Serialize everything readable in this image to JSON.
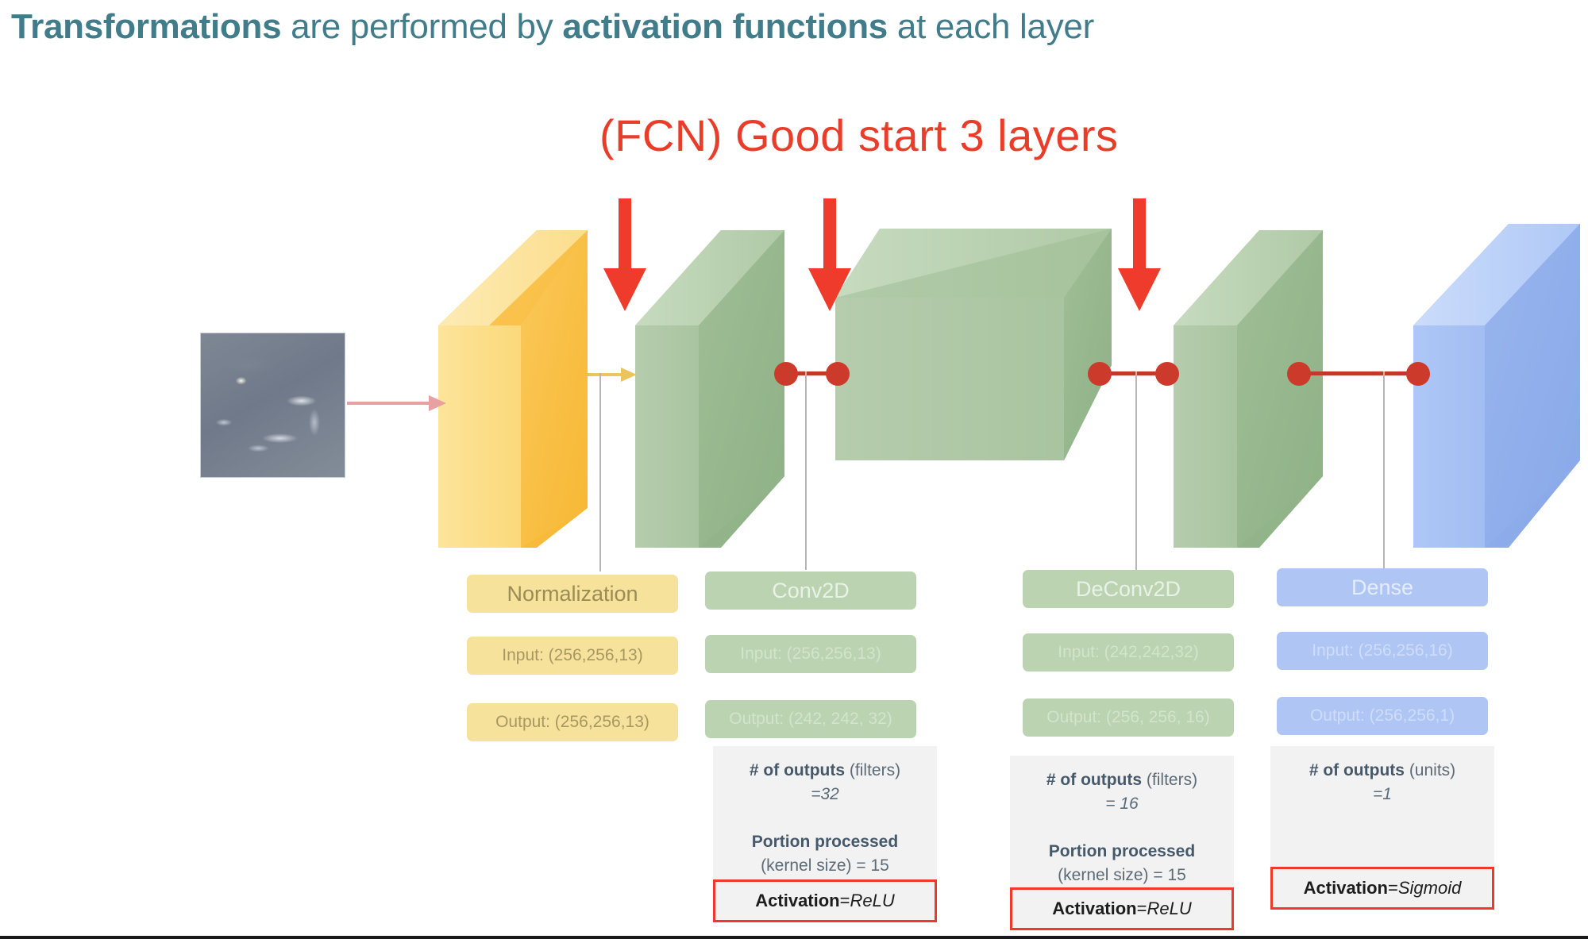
{
  "title": {
    "part1": "Transformations",
    "part2": " are performed by ",
    "part3": "activation functions",
    "part4": " at each layer",
    "color": "#417C8B"
  },
  "annotation": {
    "text": "(FCN) Good start 3 layers",
    "color": "#EA3C2A"
  },
  "arrows": {
    "count": 3,
    "color": "#EE3B2B"
  },
  "colors": {
    "yellow_face": "#FCE18A",
    "yellow_pill": "#F7E29C",
    "green_face": "#B1C8A8",
    "green_pill": "#BBD3B1",
    "blue_face": "#A8C4F5",
    "blue_pill": "#AFC5F3",
    "connector_red": "#CC3A2B",
    "activation_border": "#F0392B",
    "input_arrow": "#E8A0A0",
    "norm_arrow": "#E8C463"
  },
  "input": {
    "name": "input-satellite-image"
  },
  "layers": [
    {
      "id": "normalization",
      "name": "Normalization",
      "input": "Input: (256,256,13)",
      "output": "Output: (256,256,13)",
      "theme": "yellow",
      "details": null,
      "activation": null
    },
    {
      "id": "conv2d",
      "name": "Conv2D",
      "input": "Input: (256,256,13)",
      "output": "Output: (242, 242, 32)",
      "theme": "green",
      "details": {
        "outputs_label": "# of outputs",
        "outputs_kind": "(filters)",
        "outputs_value": "=32",
        "portion_label": "Portion processed",
        "portion_value": "(kernel size) = 15"
      },
      "activation": {
        "label": "Activation",
        "eq": " = ",
        "value": "ReLU"
      }
    },
    {
      "id": "deconv2d",
      "name": "DeConv2D",
      "input": "Input: (242,242,32)",
      "output": "Output: (256, 256, 16)",
      "theme": "green",
      "details": {
        "outputs_label": "# of outputs",
        "outputs_kind": "(filters)",
        "outputs_value": "= 16",
        "portion_label": "Portion processed",
        "portion_value": "(kernel size) = 15"
      },
      "activation": {
        "label": "Activation",
        "eq": " = ",
        "value": "ReLU"
      }
    },
    {
      "id": "dense",
      "name": "Dense",
      "input": "Input: (256,256,16)",
      "output": "Output: (256,256,1)",
      "theme": "blue",
      "details": {
        "outputs_label": "# of outputs",
        "outputs_kind": "(units)",
        "outputs_value": "=1",
        "portion_label": "",
        "portion_value": ""
      },
      "activation": {
        "label": "Activation",
        "eq": " = ",
        "value": "Sigmoid"
      }
    }
  ]
}
